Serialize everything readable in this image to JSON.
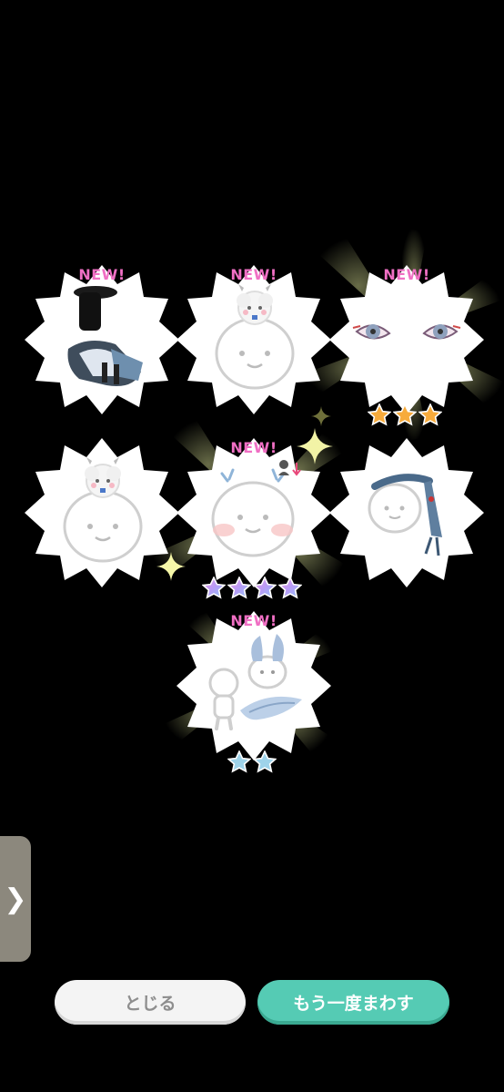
{
  "items": [
    {
      "name": "hat-and-outfit",
      "new_label": "NEW!"
    },
    {
      "name": "sheep-hat",
      "new_label": "NEW!"
    },
    {
      "name": "eyes",
      "new_label": "NEW!",
      "stars": 3,
      "star_color": "orange"
    },
    {
      "name": "sheep-hat-2",
      "new_label": ""
    },
    {
      "name": "face-blush",
      "new_label": "NEW!",
      "stars": 4,
      "star_color": "rainbow"
    },
    {
      "name": "scarf",
      "new_label": ""
    },
    {
      "name": "ears-tail",
      "new_label": "NEW!",
      "stars": 2,
      "star_color": "blue"
    }
  ],
  "side_tab": {
    "icon": "chevron-right-icon",
    "glyph": "❯"
  },
  "buttons": {
    "close_label": "とじる",
    "again_label": "もう一度まわす"
  },
  "colors": {
    "background": "#000000",
    "new_label": "#f06fc4",
    "again_button": "#55cbb4",
    "close_button": "#f4f4f4"
  }
}
